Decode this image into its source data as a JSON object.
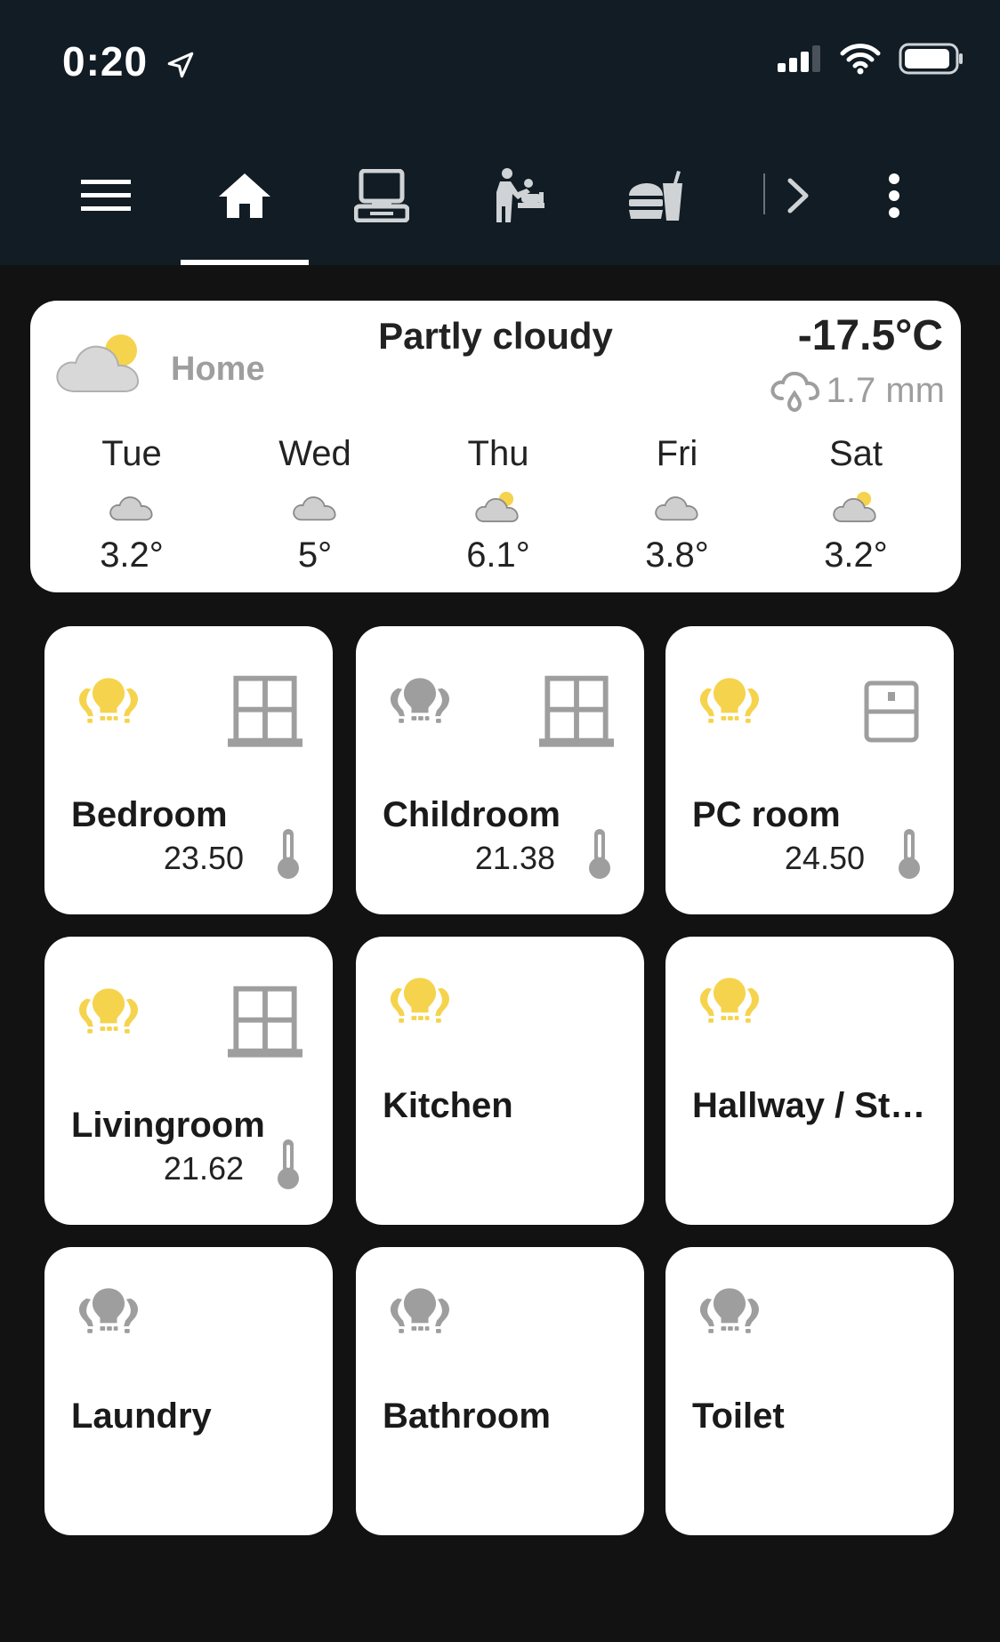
{
  "status": {
    "time": "0:20"
  },
  "colors": {
    "bulb_on": "#f5d34c",
    "bulb_off": "#9e9e9e",
    "topbar": "#111c24",
    "background": "#121212"
  },
  "nav": {
    "items": [
      "menu-icon",
      "home-icon",
      "desktop-icon",
      "baby-changing-icon",
      "food-drink-icon"
    ],
    "active": "home-icon"
  },
  "weather": {
    "condition": "Partly cloudy",
    "location": "Home",
    "temperature": "-17.5°C",
    "precipitation": "1.7 mm",
    "forecast": [
      {
        "day": "Tue",
        "temp": "3.2°",
        "icon": "cloudy-icon"
      },
      {
        "day": "Wed",
        "temp": "5°",
        "icon": "cloudy-icon"
      },
      {
        "day": "Thu",
        "temp": "6.1°",
        "icon": "partly-cloudy-icon"
      },
      {
        "day": "Fri",
        "temp": "3.8°",
        "icon": "cloudy-icon"
      },
      {
        "day": "Sat",
        "temp": "3.2°",
        "icon": "partly-cloudy-icon"
      }
    ]
  },
  "rooms": [
    {
      "name": "Bedroom",
      "temp": "23.50",
      "light": "on",
      "window": "closed"
    },
    {
      "name": "Childroom",
      "temp": "21.38",
      "light": "off",
      "window": "closed"
    },
    {
      "name": "PC room",
      "temp": "24.50",
      "light": "on",
      "window": "open"
    },
    {
      "name": "Livingroom",
      "temp": "21.62",
      "light": "on",
      "window": "closed"
    },
    {
      "name": "Kitchen",
      "light": "on"
    },
    {
      "name": "Hallway / St…",
      "light": "on"
    },
    {
      "name": "Laundry",
      "light": "off"
    },
    {
      "name": "Bathroom",
      "light": "off"
    },
    {
      "name": "Toilet",
      "light": "off"
    }
  ]
}
